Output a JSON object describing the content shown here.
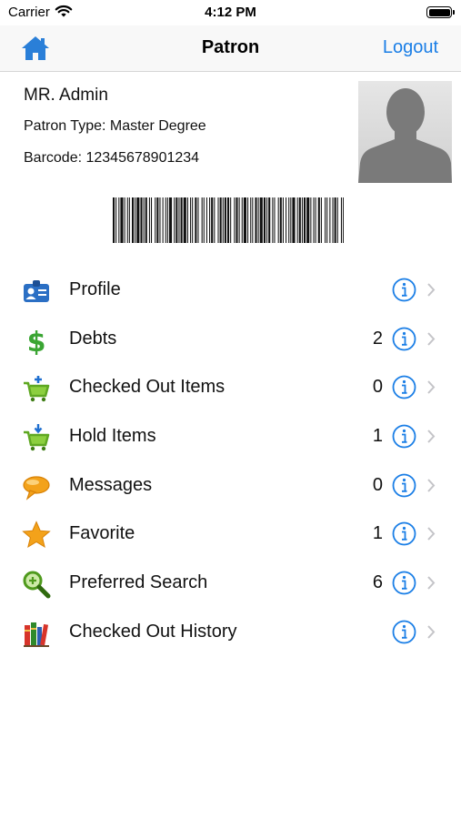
{
  "status_bar": {
    "carrier": "Carrier",
    "time": "4:12 PM"
  },
  "nav": {
    "title": "Patron",
    "logout_label": "Logout",
    "home_icon": "home-icon"
  },
  "patron": {
    "name": "MR. Admin",
    "type": "Patron Type: Master Degree",
    "barcode": "Barcode: 12345678901234"
  },
  "menu": {
    "items": [
      {
        "label": "Profile",
        "count": "",
        "icon": "profile-card-icon"
      },
      {
        "label": "Debts",
        "count": "2",
        "icon": "dollar-icon"
      },
      {
        "label": "Checked Out Items",
        "count": "0",
        "icon": "cart-add-icon"
      },
      {
        "label": "Hold Items",
        "count": "1",
        "icon": "cart-hold-icon"
      },
      {
        "label": "Messages",
        "count": "0",
        "icon": "speech-bubble-icon"
      },
      {
        "label": "Favorite",
        "count": "1",
        "icon": "star-icon"
      },
      {
        "label": "Preferred Search",
        "count": "6",
        "icon": "magnifier-icon"
      },
      {
        "label": "Checked Out History",
        "count": "",
        "icon": "books-icon"
      }
    ]
  },
  "colors": {
    "accent": "#1a7ee6",
    "nav_bg": "#f8f8f8"
  }
}
